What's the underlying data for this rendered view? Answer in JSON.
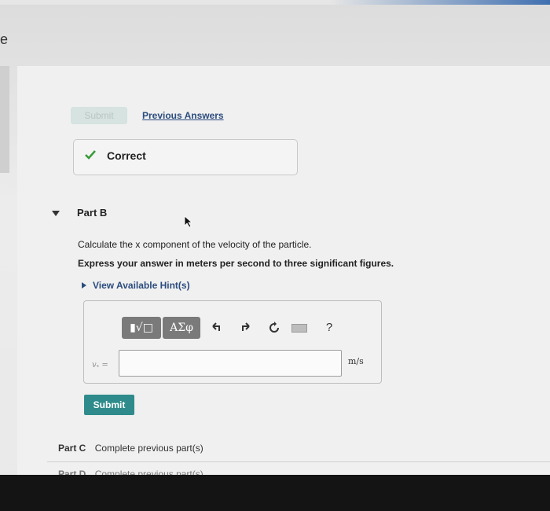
{
  "left_fragment": "e",
  "submit_faded_label": "Submit",
  "previous_answers_label": "Previous Answers",
  "feedback": {
    "status_label": "Correct",
    "icon": "check-icon",
    "color": "#3a9a3a"
  },
  "part_b": {
    "label": "Part B",
    "question": "Calculate the x component of the velocity of the particle.",
    "instruction": "Express your answer in meters per second to three significant figures.",
    "hint_label": "View Available Hint(s)"
  },
  "toolbar": {
    "templates_label": "▮√□",
    "greek_label": "ΑΣφ",
    "undo_icon": "undo-icon",
    "redo_icon": "redo-icon",
    "reset_icon": "reset-icon",
    "keyboard_icon": "keyboard-icon",
    "help_label": "?"
  },
  "answer": {
    "variable_label": "vₓ =",
    "value": "",
    "unit": "m/s"
  },
  "submit_label": "Submit",
  "parts_after": [
    {
      "label": "Part C",
      "status": "Complete previous part(s)"
    },
    {
      "label": "Part D",
      "status": "Complete previous part(s)"
    }
  ],
  "colors": {
    "link": "#2b4c7e",
    "submit_bg": "#2f8b8b",
    "correct_check": "#3a9a3a"
  }
}
